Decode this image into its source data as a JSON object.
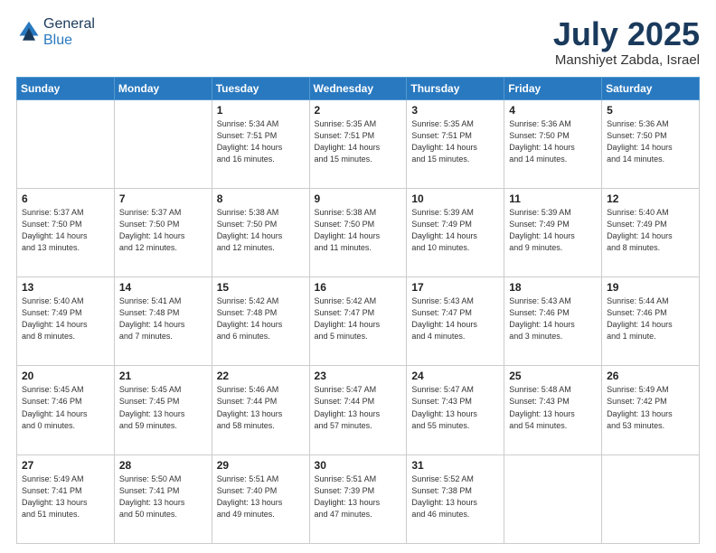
{
  "logo": {
    "general": "General",
    "blue": "Blue"
  },
  "title": {
    "month": "July 2025",
    "location": "Manshiyet Zabda, Israel"
  },
  "header_days": [
    "Sunday",
    "Monday",
    "Tuesday",
    "Wednesday",
    "Thursday",
    "Friday",
    "Saturday"
  ],
  "weeks": [
    [
      {
        "day": "",
        "info": ""
      },
      {
        "day": "",
        "info": ""
      },
      {
        "day": "1",
        "info": "Sunrise: 5:34 AM\nSunset: 7:51 PM\nDaylight: 14 hours\nand 16 minutes."
      },
      {
        "day": "2",
        "info": "Sunrise: 5:35 AM\nSunset: 7:51 PM\nDaylight: 14 hours\nand 15 minutes."
      },
      {
        "day": "3",
        "info": "Sunrise: 5:35 AM\nSunset: 7:51 PM\nDaylight: 14 hours\nand 15 minutes."
      },
      {
        "day": "4",
        "info": "Sunrise: 5:36 AM\nSunset: 7:50 PM\nDaylight: 14 hours\nand 14 minutes."
      },
      {
        "day": "5",
        "info": "Sunrise: 5:36 AM\nSunset: 7:50 PM\nDaylight: 14 hours\nand 14 minutes."
      }
    ],
    [
      {
        "day": "6",
        "info": "Sunrise: 5:37 AM\nSunset: 7:50 PM\nDaylight: 14 hours\nand 13 minutes."
      },
      {
        "day": "7",
        "info": "Sunrise: 5:37 AM\nSunset: 7:50 PM\nDaylight: 14 hours\nand 12 minutes."
      },
      {
        "day": "8",
        "info": "Sunrise: 5:38 AM\nSunset: 7:50 PM\nDaylight: 14 hours\nand 12 minutes."
      },
      {
        "day": "9",
        "info": "Sunrise: 5:38 AM\nSunset: 7:50 PM\nDaylight: 14 hours\nand 11 minutes."
      },
      {
        "day": "10",
        "info": "Sunrise: 5:39 AM\nSunset: 7:49 PM\nDaylight: 14 hours\nand 10 minutes."
      },
      {
        "day": "11",
        "info": "Sunrise: 5:39 AM\nSunset: 7:49 PM\nDaylight: 14 hours\nand 9 minutes."
      },
      {
        "day": "12",
        "info": "Sunrise: 5:40 AM\nSunset: 7:49 PM\nDaylight: 14 hours\nand 8 minutes."
      }
    ],
    [
      {
        "day": "13",
        "info": "Sunrise: 5:40 AM\nSunset: 7:49 PM\nDaylight: 14 hours\nand 8 minutes."
      },
      {
        "day": "14",
        "info": "Sunrise: 5:41 AM\nSunset: 7:48 PM\nDaylight: 14 hours\nand 7 minutes."
      },
      {
        "day": "15",
        "info": "Sunrise: 5:42 AM\nSunset: 7:48 PM\nDaylight: 14 hours\nand 6 minutes."
      },
      {
        "day": "16",
        "info": "Sunrise: 5:42 AM\nSunset: 7:47 PM\nDaylight: 14 hours\nand 5 minutes."
      },
      {
        "day": "17",
        "info": "Sunrise: 5:43 AM\nSunset: 7:47 PM\nDaylight: 14 hours\nand 4 minutes."
      },
      {
        "day": "18",
        "info": "Sunrise: 5:43 AM\nSunset: 7:46 PM\nDaylight: 14 hours\nand 3 minutes."
      },
      {
        "day": "19",
        "info": "Sunrise: 5:44 AM\nSunset: 7:46 PM\nDaylight: 14 hours\nand 1 minute."
      }
    ],
    [
      {
        "day": "20",
        "info": "Sunrise: 5:45 AM\nSunset: 7:46 PM\nDaylight: 14 hours\nand 0 minutes."
      },
      {
        "day": "21",
        "info": "Sunrise: 5:45 AM\nSunset: 7:45 PM\nDaylight: 13 hours\nand 59 minutes."
      },
      {
        "day": "22",
        "info": "Sunrise: 5:46 AM\nSunset: 7:44 PM\nDaylight: 13 hours\nand 58 minutes."
      },
      {
        "day": "23",
        "info": "Sunrise: 5:47 AM\nSunset: 7:44 PM\nDaylight: 13 hours\nand 57 minutes."
      },
      {
        "day": "24",
        "info": "Sunrise: 5:47 AM\nSunset: 7:43 PM\nDaylight: 13 hours\nand 55 minutes."
      },
      {
        "day": "25",
        "info": "Sunrise: 5:48 AM\nSunset: 7:43 PM\nDaylight: 13 hours\nand 54 minutes."
      },
      {
        "day": "26",
        "info": "Sunrise: 5:49 AM\nSunset: 7:42 PM\nDaylight: 13 hours\nand 53 minutes."
      }
    ],
    [
      {
        "day": "27",
        "info": "Sunrise: 5:49 AM\nSunset: 7:41 PM\nDaylight: 13 hours\nand 51 minutes."
      },
      {
        "day": "28",
        "info": "Sunrise: 5:50 AM\nSunset: 7:41 PM\nDaylight: 13 hours\nand 50 minutes."
      },
      {
        "day": "29",
        "info": "Sunrise: 5:51 AM\nSunset: 7:40 PM\nDaylight: 13 hours\nand 49 minutes."
      },
      {
        "day": "30",
        "info": "Sunrise: 5:51 AM\nSunset: 7:39 PM\nDaylight: 13 hours\nand 47 minutes."
      },
      {
        "day": "31",
        "info": "Sunrise: 5:52 AM\nSunset: 7:38 PM\nDaylight: 13 hours\nand 46 minutes."
      },
      {
        "day": "",
        "info": ""
      },
      {
        "day": "",
        "info": ""
      }
    ]
  ]
}
